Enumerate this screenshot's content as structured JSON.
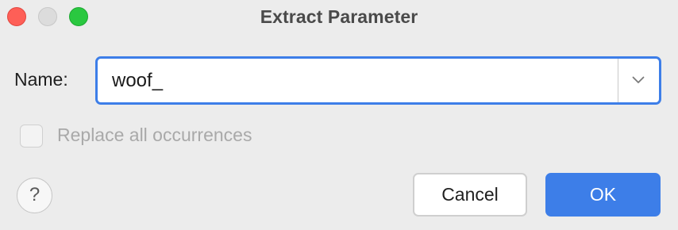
{
  "window": {
    "title": "Extract Parameter"
  },
  "form": {
    "name_label": "Name:",
    "name_value": "woof_",
    "replace_all_label": "Replace all occurrences",
    "replace_all_checked": false,
    "replace_all_enabled": false
  },
  "buttons": {
    "help_label": "?",
    "cancel_label": "Cancel",
    "ok_label": "OK"
  },
  "icons": {
    "dropdown": "chevron-down-icon",
    "help": "question-mark-icon"
  },
  "colors": {
    "accent": "#3d7ee8",
    "close": "#fe5f57",
    "minimize": "#dcdcdc",
    "maximize": "#2ac840",
    "disabled_text": "#a9a9a9"
  }
}
